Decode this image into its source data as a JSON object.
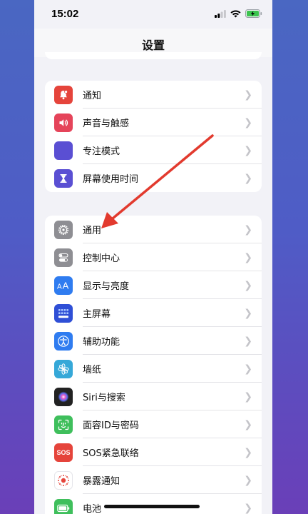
{
  "status": {
    "time": "15:02"
  },
  "header": {
    "title": "设置"
  },
  "groups": [
    {
      "items": [
        {
          "label": "通知",
          "icon": "bell-icon",
          "color": "#e5443b"
        },
        {
          "label": "声音与触感",
          "icon": "speaker-icon",
          "color": "#e5445a"
        },
        {
          "label": "专注模式",
          "icon": "moon-icon",
          "color": "#5a4fd3"
        },
        {
          "label": "屏幕使用时间",
          "icon": "hourglass-icon",
          "color": "#5a4fd3"
        }
      ]
    },
    {
      "items": [
        {
          "label": "通用",
          "icon": "gear-icon",
          "color": "#8e8e93"
        },
        {
          "label": "控制中心",
          "icon": "toggles-icon",
          "color": "#8e8e93"
        },
        {
          "label": "显示与亮度",
          "icon": "text-size-icon",
          "color": "#2f7cf0"
        },
        {
          "label": "主屏幕",
          "icon": "grid-icon",
          "color": "#2f4fd6"
        },
        {
          "label": "辅助功能",
          "icon": "accessibility-icon",
          "color": "#2f7cf0"
        },
        {
          "label": "墙纸",
          "icon": "flower-icon",
          "color": "#35a8d8"
        },
        {
          "label": "Siri与搜索",
          "icon": "siri-icon",
          "color": "#222222"
        },
        {
          "label": "面容ID与密码",
          "icon": "face-id-icon",
          "color": "#3fbf5c"
        },
        {
          "label": "SOS紧急联络",
          "icon": "sos-icon",
          "color": "#e5443b",
          "icon_text": "SOS"
        },
        {
          "label": "暴露通知",
          "icon": "exposure-icon",
          "color": "#ffffff"
        },
        {
          "label": "电池",
          "icon": "battery-icon",
          "color": "#3fbf5c"
        }
      ]
    }
  ],
  "annotation": {
    "arrow_color": "#e23a2e"
  }
}
